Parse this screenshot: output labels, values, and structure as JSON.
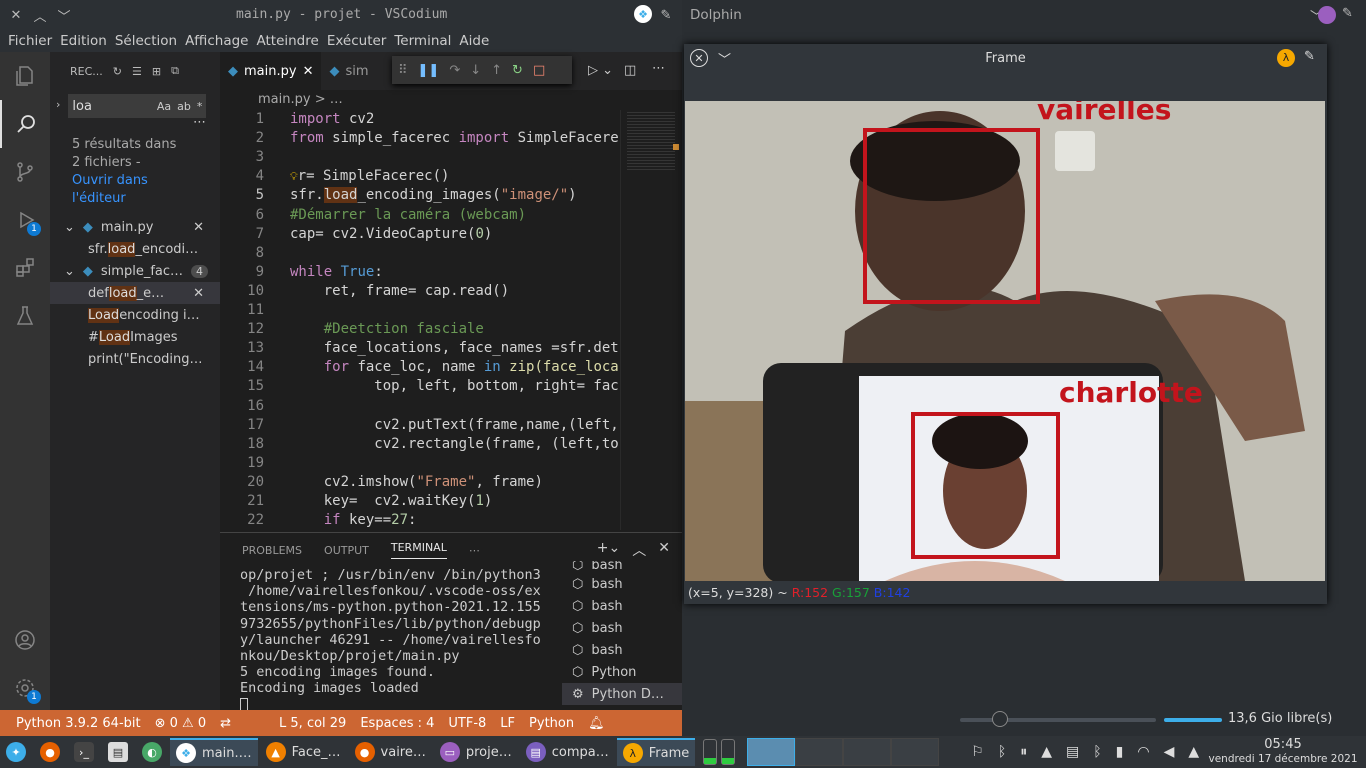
{
  "vscode": {
    "title": "main.py - projet - VSCodium",
    "menu": [
      "Fichier",
      "Edition",
      "Sélection",
      "Affichage",
      "Atteindre",
      "Exécuter",
      "Terminal",
      "Aide"
    ],
    "activity_badge": "1",
    "account_badge": "1",
    "sidebar": {
      "header": "REC...",
      "search_value": "loa",
      "search_opts": [
        "Aa",
        "ab",
        "*"
      ],
      "result_text_1": "5 résultats dans",
      "result_text_2": "2 fichiers -",
      "result_link_1": "Ouvrir dans",
      "result_link_2": "l'éditeur",
      "file1": "main.py",
      "file1_match_pre": "sfr.",
      "file1_match_hl": "load",
      "file1_match_post": "_encodi…",
      "file2": "simple_fac…",
      "file2_count": "4",
      "m1_pre": "def ",
      "m1_hl": "load",
      "m1_post": "_e…",
      "m2_hl": "Load",
      "m2_post": " encoding i…",
      "m3_pre": "# ",
      "m3_hl": "Load",
      "m3_post": " Images",
      "m4_pre": "print(\"Encoding…"
    },
    "tabs": [
      {
        "label": "main.py"
      },
      {
        "label": "sim"
      }
    ],
    "breadcrumb": "main.py > …",
    "code_lines": [
      "1",
      "2",
      "3",
      "4",
      "5",
      "6",
      "7",
      "8",
      "9",
      "10",
      "11",
      "12",
      "13",
      "14",
      "15",
      "16",
      "17",
      "18",
      "19",
      "20",
      "21",
      "22"
    ],
    "code": {
      "l1a": "import",
      "l1b": " cv2",
      "l2a": "from",
      "l2b": " simple_facerec ",
      "l2c": "import",
      "l2d": " SimpleFacere",
      "l4": "r= SimpleFacerec()",
      "l5a": "sfr.",
      "l5b": "load",
      "l5c": "_encoding_images(",
      "l5d": "\"image/\"",
      "l5e": ")",
      "l6": "#Démarrer la caméra (webcam)",
      "l7a": "cap= cv2.VideoCapture(",
      "l7b": "0",
      "l7c": ")",
      "l9a": "while",
      "l9b": " True",
      ":": ":",
      "l10": "    ret, frame= cap.read()",
      "l12": "    #Deetction fasciale",
      "l13": "    face_locations, face_names =sfr.det",
      "l14a": "    for",
      "l14b": " face_loc, name ",
      "l14c": "in",
      "l14d": " zip(face_loca",
      "l15": "          top, left, bottom, right= fac",
      "l17": "          cv2.putText(frame,name,(left,",
      "l18": "          cv2.rectangle(frame, (left,to",
      "l20a": "    cv2.imshow(",
      "l20b": "\"Frame\"",
      "l20c": ", frame)",
      "l21a": "    key=  cv2.waitKey(",
      "l21b": "1",
      "l21c": ")",
      "l22a": "    if",
      "l22b": " key==",
      "l22c": "27",
      ":2": ":"
    },
    "panel_tabs": [
      "PROBLEMS",
      "OUTPUT",
      "TERMINAL"
    ],
    "terminal": [
      "op/projet ; /usr/bin/env /bin/python3",
      " /home/vairellesfonkou/.vscode-oss/ex",
      "tensions/ms-python.python-2021.12.155",
      "9732655/pythonFiles/lib/python/debugp",
      "y/launcher 46291 -- /home/vairellesfo",
      "nkou/Desktop/projet/main.py",
      "5 encoding images found.",
      "Encoding images loaded"
    ],
    "terminals": [
      "bash",
      "bash",
      "bash",
      "bash",
      "bash",
      "Python",
      "Python D…"
    ],
    "status": {
      "python": "Python 3.9.2 64-bit",
      "errors": "0",
      "warnings": "0",
      "pos": "L 5, col 29",
      "spaces": "Espaces : 4",
      "enc": "UTF-8",
      "eol": "LF",
      "lang": "Python"
    }
  },
  "dolphin": {
    "title": "Dolphin",
    "free": "13,6 Gio libre(s)"
  },
  "frame": {
    "title": "Frame",
    "label1": "vairelles",
    "label2": "charlotte",
    "coord": "(x=5, y=328) ~ ",
    "r": "R:152",
    "g": "G:157",
    "b": "B:142"
  },
  "taskbar": {
    "items": [
      "main.…",
      "Face_…",
      "vaire…",
      "proje…",
      "compa…",
      "Frame"
    ],
    "time": "05:45",
    "date": "vendredi 17 décembre 2021"
  }
}
